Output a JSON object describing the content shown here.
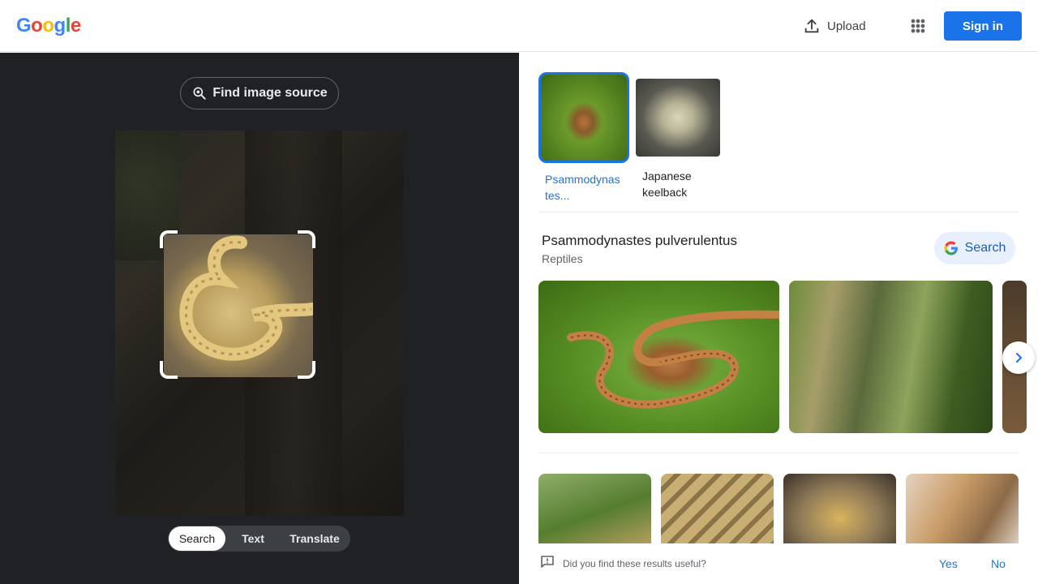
{
  "header": {
    "logo_letters": [
      "G",
      "o",
      "o",
      "g",
      "l",
      "e"
    ],
    "logo_colors": [
      "#4285F4",
      "#EA4335",
      "#FBBC05",
      "#4285F4",
      "#34A853",
      "#EA4335"
    ],
    "upload_label": "Upload",
    "apps_icon": "apps-grid-icon",
    "signin_label": "Sign in",
    "accent": "#1a73e8"
  },
  "left": {
    "find_source_label": "Find image source",
    "modes": [
      {
        "label": "Search",
        "active": true
      },
      {
        "label": "Text",
        "active": false
      },
      {
        "label": "Translate",
        "active": false
      }
    ]
  },
  "right": {
    "chips": [
      {
        "label": "Psammodynas tes...",
        "selected": true
      },
      {
        "label": "Japanese keelback",
        "selected": false
      }
    ],
    "entity": {
      "title": "Psammodynastes pulverulentus",
      "subtitle": "Reptiles",
      "search_label": "Search"
    },
    "feedback": {
      "question": "Did you find these results useful?",
      "yes": "Yes",
      "no": "No"
    }
  }
}
